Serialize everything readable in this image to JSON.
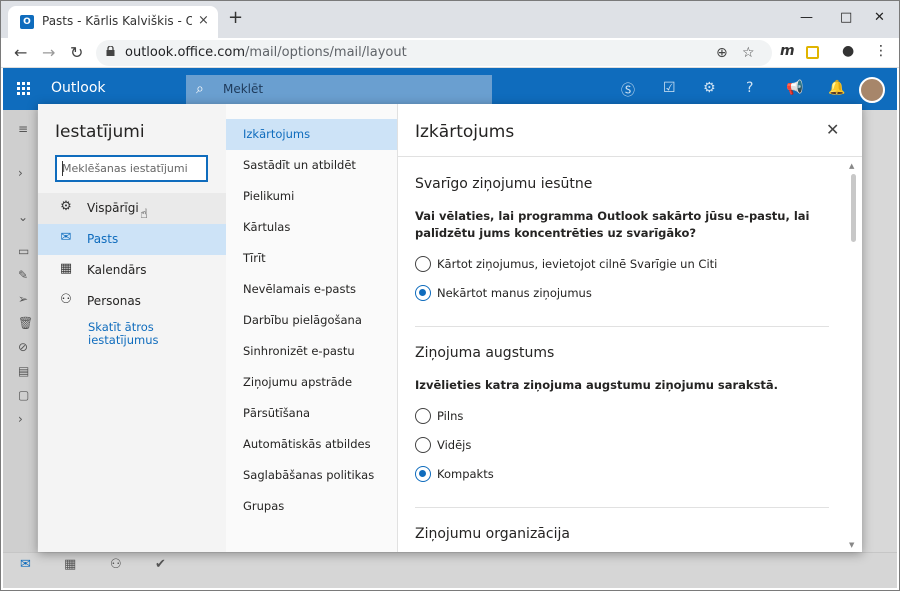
{
  "browser": {
    "tab_title": "Pasts - Kārlis Kalviškis - Outlook",
    "tab_close": "×",
    "new_tab": "+",
    "url_domain": "outlook.office.com",
    "url_path": "/mail/options/mail/layout",
    "window_controls": [
      "—",
      "□",
      "✕"
    ]
  },
  "outlook": {
    "brand": "Outlook",
    "search_placeholder": "Meklēt"
  },
  "settings": {
    "title": "Iestatījumi",
    "search_placeholder": "Meklēšanas iestatījumi",
    "categories": [
      {
        "label": "Vispārīgi",
        "icon": "gear-icon"
      },
      {
        "label": "Pasts",
        "icon": "mail-icon"
      },
      {
        "label": "Kalendārs",
        "icon": "calendar-icon"
      },
      {
        "label": "Personas",
        "icon": "people-icon"
      }
    ],
    "quick_settings_link": "Skatīt ātros iestatījumus",
    "subcategories": [
      "Izkārtojums",
      "Sastādīt un atbildēt",
      "Pielikumi",
      "Kārtulas",
      "Tīrīt",
      "Nevēlamais e-pasts",
      "Darbību pielāgošana",
      "Sinhronizēt e-pastu",
      "Ziņojumu apstrāde",
      "Pārsūtīšana",
      "Automātiskās atbildes",
      "Saglabāšanas politikas",
      "Grupas"
    ],
    "selected_subcategory": "Izkārtojums"
  },
  "pane": {
    "title": "Izkārtojums",
    "close": "✕",
    "sections": [
      {
        "heading": "Svarīgo ziņojumu iesūtne",
        "question": "Vai vēlaties, lai programma Outlook sakārto jūsu e-pastu, lai palīdzētu jums koncentrēties uz svarīgāko?",
        "options": [
          {
            "label": "Kārtot ziņojumus, ievietojot cilnē Svarīgie un Citi",
            "checked": false
          },
          {
            "label": "Nekārtot manus ziņojumus",
            "checked": true
          }
        ]
      },
      {
        "heading": "Ziņojuma augstums",
        "question": "Izvēlieties katra ziņojuma augstumu ziņojumu sarakstā.",
        "options": [
          {
            "label": "Pilns",
            "checked": false
          },
          {
            "label": "Vidējs",
            "checked": false
          },
          {
            "label": "Kompakts",
            "checked": true
          }
        ]
      },
      {
        "heading": "Ziņojumu organizācija"
      }
    ]
  },
  "colors": {
    "accent": "#0f6cbd",
    "selected_bg": "#cde3f7"
  }
}
